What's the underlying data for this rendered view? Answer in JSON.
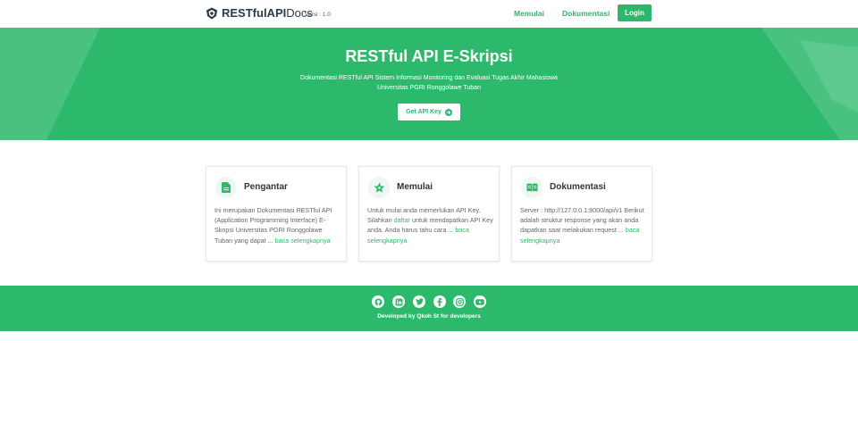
{
  "navbar": {
    "brand_strong": "RESTfulAPI",
    "brand_light": "Docs",
    "version": "Versi : 1.0",
    "links": [
      "Memulai",
      "Dokumentasi"
    ],
    "login_label": "Login"
  },
  "hero": {
    "title": "RESTful API E-Skripsi",
    "subtitle_line1": "Dokumentasi RESTful API Sistem Informasi Monitoring dan Evaluasi Tugas Akhir Mahasiswa",
    "subtitle_line2": "Universitas PGRI Ronggolawe Tuban",
    "button_label": "Get API Key"
  },
  "cards": [
    {
      "icon": "document-icon",
      "title": "Pengantar",
      "text": "Ini merupakan Dokumentasi RESTful API (Application Programming Interface) E-Skripsi Universitas PGRI Ronggolawe Tuban yang dapat ...",
      "more": "baca selengkapnya"
    },
    {
      "icon": "star-icon",
      "title": "Memulai",
      "text_before": "Untuk mulai anda memerlukan API Key. Silahkan",
      "text_link": "daftar",
      "text_after": "untuk mendapatkan API Key anda. Anda harus tahu cara ...",
      "more": "baca selengkapnya"
    },
    {
      "icon": "book-icon",
      "title": "Dokumentasi",
      "text": "Server : http://127.0.0.1:8000/api/v1 Berikut adalah struktur response yang akan anda dapatkan saat melakukan request ...",
      "more": "baca selengkapnya"
    }
  ],
  "footer": {
    "social_icons": [
      "github-icon",
      "linkedin-icon",
      "twitter-icon",
      "facebook-icon",
      "instagram-icon",
      "youtube-icon"
    ],
    "credit": "Developed by Qkoh St for developers"
  },
  "colors": {
    "accent": "#2db96b",
    "dark": "#2b3a4a"
  }
}
